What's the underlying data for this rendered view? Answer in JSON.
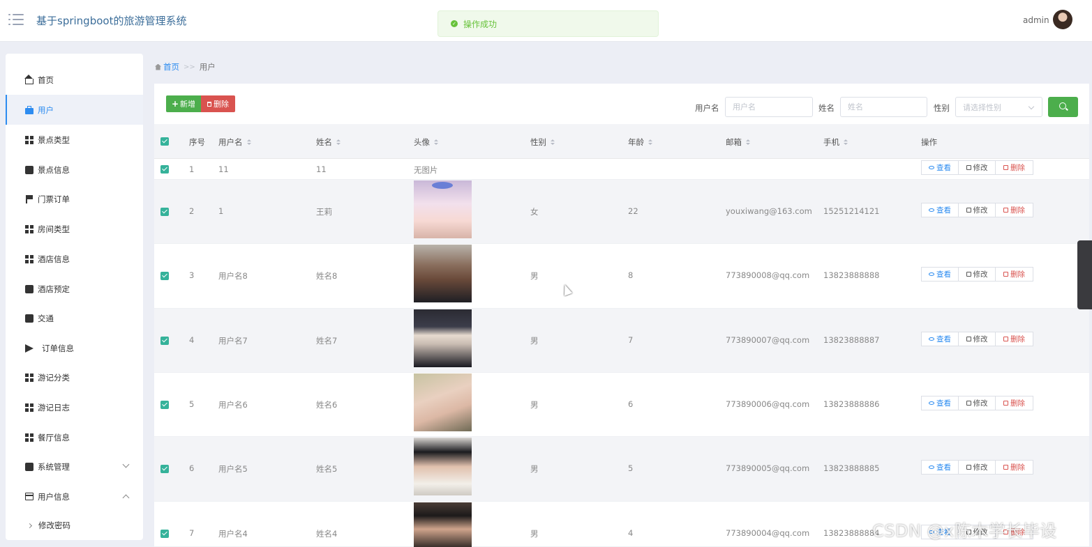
{
  "header": {
    "title": "基于springboot的旅游管理系统",
    "toast": "操作成功",
    "username": "admin",
    "toast_color": "#67c23a"
  },
  "sidebar": {
    "items": [
      {
        "label": "首页",
        "icon": "home-icon"
      },
      {
        "label": "用户",
        "icon": "briefcase-icon"
      },
      {
        "label": "景点类型",
        "icon": "grid-icon"
      },
      {
        "label": "景点信息",
        "icon": "grid-icon"
      },
      {
        "label": "门票订单",
        "icon": "flag-icon"
      },
      {
        "label": "房间类型",
        "icon": "grid-icon"
      },
      {
        "label": "酒店信息",
        "icon": "grid-icon"
      },
      {
        "label": "酒店预定",
        "icon": "clipboard-icon"
      },
      {
        "label": "交通",
        "icon": "sign-icon"
      },
      {
        "label": "订单信息",
        "icon": "paper-plane-icon"
      },
      {
        "label": "游记分类",
        "icon": "grid-icon"
      },
      {
        "label": "游记日志",
        "icon": "grid-icon"
      },
      {
        "label": "餐厅信息",
        "icon": "grid-icon"
      },
      {
        "label": "系统管理",
        "icon": "clipboard-x-icon"
      },
      {
        "label": "用户信息",
        "icon": "card-icon"
      }
    ],
    "sub_items": [
      {
        "label": "修改密码"
      }
    ],
    "active_color": "#2d8cf0"
  },
  "breadcrumb": {
    "home": "首页",
    "separator": ">>",
    "current": "用户"
  },
  "toolbar": {
    "add_label": "新增",
    "delete_label": "删除",
    "username_label": "用户名",
    "username_placeholder": "用户名",
    "name_label": "姓名",
    "name_placeholder": "姓名",
    "gender_label": "性别",
    "gender_placeholder": "请选择性别"
  },
  "table": {
    "headers": {
      "index": "序号",
      "username": "用户名",
      "name": "姓名",
      "avatar": "头像",
      "gender": "性别",
      "age": "年龄",
      "email": "邮箱",
      "phone": "手机",
      "actions": "操作"
    },
    "action_labels": {
      "view": "查看",
      "edit": "修改",
      "delete": "删除"
    },
    "rows": [
      {
        "index": "1",
        "username": "11",
        "name": "11",
        "avatar": "无图片",
        "gender": "",
        "age": "",
        "email": "",
        "phone": ""
      },
      {
        "index": "2",
        "username": "1",
        "name": "王莉",
        "avatar": "",
        "gender": "女",
        "age": "22",
        "email": "youxiwang@163.com",
        "phone": "15251214121"
      },
      {
        "index": "3",
        "username": "用户名8",
        "name": "姓名8",
        "avatar": "",
        "gender": "男",
        "age": "8",
        "email": "773890008@qq.com",
        "phone": "13823888888"
      },
      {
        "index": "4",
        "username": "用户名7",
        "name": "姓名7",
        "avatar": "",
        "gender": "男",
        "age": "7",
        "email": "773890007@qq.com",
        "phone": "13823888887"
      },
      {
        "index": "5",
        "username": "用户名6",
        "name": "姓名6",
        "avatar": "",
        "gender": "男",
        "age": "6",
        "email": "773890006@qq.com",
        "phone": "13823888886"
      },
      {
        "index": "6",
        "username": "用户名5",
        "name": "姓名5",
        "avatar": "",
        "gender": "男",
        "age": "5",
        "email": "773890005@qq.com",
        "phone": "13823888885"
      },
      {
        "index": "7",
        "username": "用户名4",
        "name": "姓名4",
        "avatar": "",
        "gender": "男",
        "age": "4",
        "email": "773890004@qq.com",
        "phone": "13823888884"
      }
    ]
  },
  "watermark": "CSDN @x陈木学长毕设"
}
